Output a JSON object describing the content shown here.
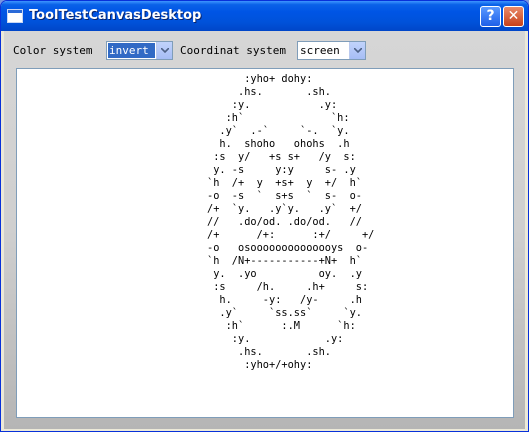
{
  "window": {
    "title": "ToolTestCanvasDesktop",
    "help_glyph": "?",
    "close_glyph": "✕",
    "icon": "window-app-icon"
  },
  "toolbar": {
    "color_label": "Color system",
    "color_value": "invert",
    "coord_label": "Coordinat system",
    "coord_value": "screen",
    "dropdown_icon": "chevron-down-icon"
  },
  "canvas": {
    "lines": [
      "      :yho+ dohy:",
      "     .hs.       .sh.",
      "    :y.           .y:",
      "   :h`              `h:",
      "  .y`  .-`     `-.  `y.",
      "  h.  shoho   ohohs  .h",
      " :s  y/   +s s+   /y  s:",
      " y. -s     y:y     s- .y",
      "`h  /+  y  +s+  y  +/  h`",
      "-o  -s  `  s+s  `  s-  o-",
      "/+  `y.   .y`y.   .y`  +/",
      "//   .do/od. .do/od.   //",
      "/+      /+:      :+/     +/",
      "-o   osoooooooooooooys  o-",
      "`h  /N+-----------+N+  h`",
      " y.  .yo          oy.  .y",
      " :s     /h.     .h+     s:",
      "  h.     -y:   /y-     .h",
      "  .y`     `ss.ss`     `y.",
      "   :h`      :.M      `h:",
      "    :y.            .y:",
      "     .hs.       .sh.",
      "      :yho+/+ohy:"
    ]
  },
  "colors": {
    "title_bar": "#0054e3",
    "selection": "#316ac5",
    "client_bg": "#cfcfcf"
  }
}
